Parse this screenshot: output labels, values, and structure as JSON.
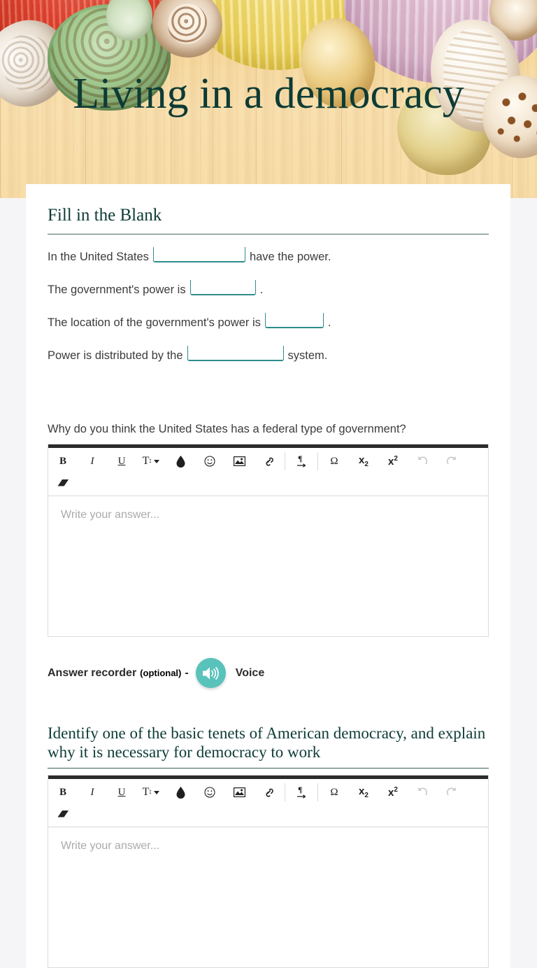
{
  "banner": {
    "title": "Living in a democracy",
    "title_color": "#0d3b35",
    "background": "seashells-on-wood-photo"
  },
  "page": {
    "background_color": "#f5f5f7",
    "card_background": "#ffffff",
    "accent_color": "#2f8c8c",
    "recorder_color": "#59c2bb"
  },
  "fill_in_the_blank": {
    "heading": "Fill in the Blank",
    "lines": [
      {
        "before": "In the United States",
        "value": "",
        "after": "have the power."
      },
      {
        "before": "The government's power is",
        "value": "",
        "after": "."
      },
      {
        "before": "The location of the government's power is",
        "value": "",
        "after": "."
      },
      {
        "before": "Power is distributed by the",
        "value": "",
        "after": "system."
      }
    ]
  },
  "questions": [
    {
      "prompt": "Why do you think the United States has a federal type of government?",
      "style": "sans",
      "editor": {
        "placeholder": "Write your answer...",
        "value": ""
      },
      "recorder": {
        "label": "Answer recorder",
        "optional": "(optional)",
        "dash": "-",
        "button_icon": "speaker-icon",
        "voice_label": "Voice"
      }
    },
    {
      "prompt": "Identify one of the basic tenets of American democracy, and explain why it is necessary for democracy to work",
      "style": "serif",
      "editor": {
        "placeholder": "Write your answer...",
        "value": ""
      }
    }
  ],
  "toolbar": {
    "items": [
      {
        "name": "bold-button",
        "label": "B",
        "kind": "bold",
        "disabled": false
      },
      {
        "name": "italic-button",
        "label": "I",
        "kind": "italic",
        "disabled": false
      },
      {
        "name": "underline-button",
        "label": "U",
        "kind": "underline",
        "disabled": false
      },
      {
        "name": "font-size-button",
        "label": "T",
        "kind": "fontsize",
        "disabled": false
      },
      {
        "name": "text-color-button",
        "label": "",
        "kind": "droplet",
        "disabled": false
      },
      {
        "name": "emoji-button",
        "label": "☺",
        "kind": "glyph",
        "disabled": false
      },
      {
        "name": "insert-image-button",
        "label": "",
        "kind": "image",
        "disabled": false
      },
      {
        "name": "insert-link-button",
        "label": "",
        "kind": "link",
        "disabled": false
      },
      {
        "name": "paragraph-direction-button",
        "label": "¶",
        "kind": "paragraph",
        "disabled": false
      },
      {
        "name": "special-character-button",
        "label": "Ω",
        "kind": "glyph",
        "disabled": false
      },
      {
        "name": "subscript-button",
        "label": "x",
        "kind": "sub",
        "disabled": false
      },
      {
        "name": "superscript-button",
        "label": "x",
        "kind": "sup",
        "disabled": false
      },
      {
        "name": "undo-button",
        "label": "↺",
        "kind": "undo",
        "disabled": true
      },
      {
        "name": "redo-button",
        "label": "↻",
        "kind": "redo",
        "disabled": true
      },
      {
        "name": "clear-formatting-button",
        "label": "",
        "kind": "eraser",
        "disabled": false
      }
    ]
  }
}
